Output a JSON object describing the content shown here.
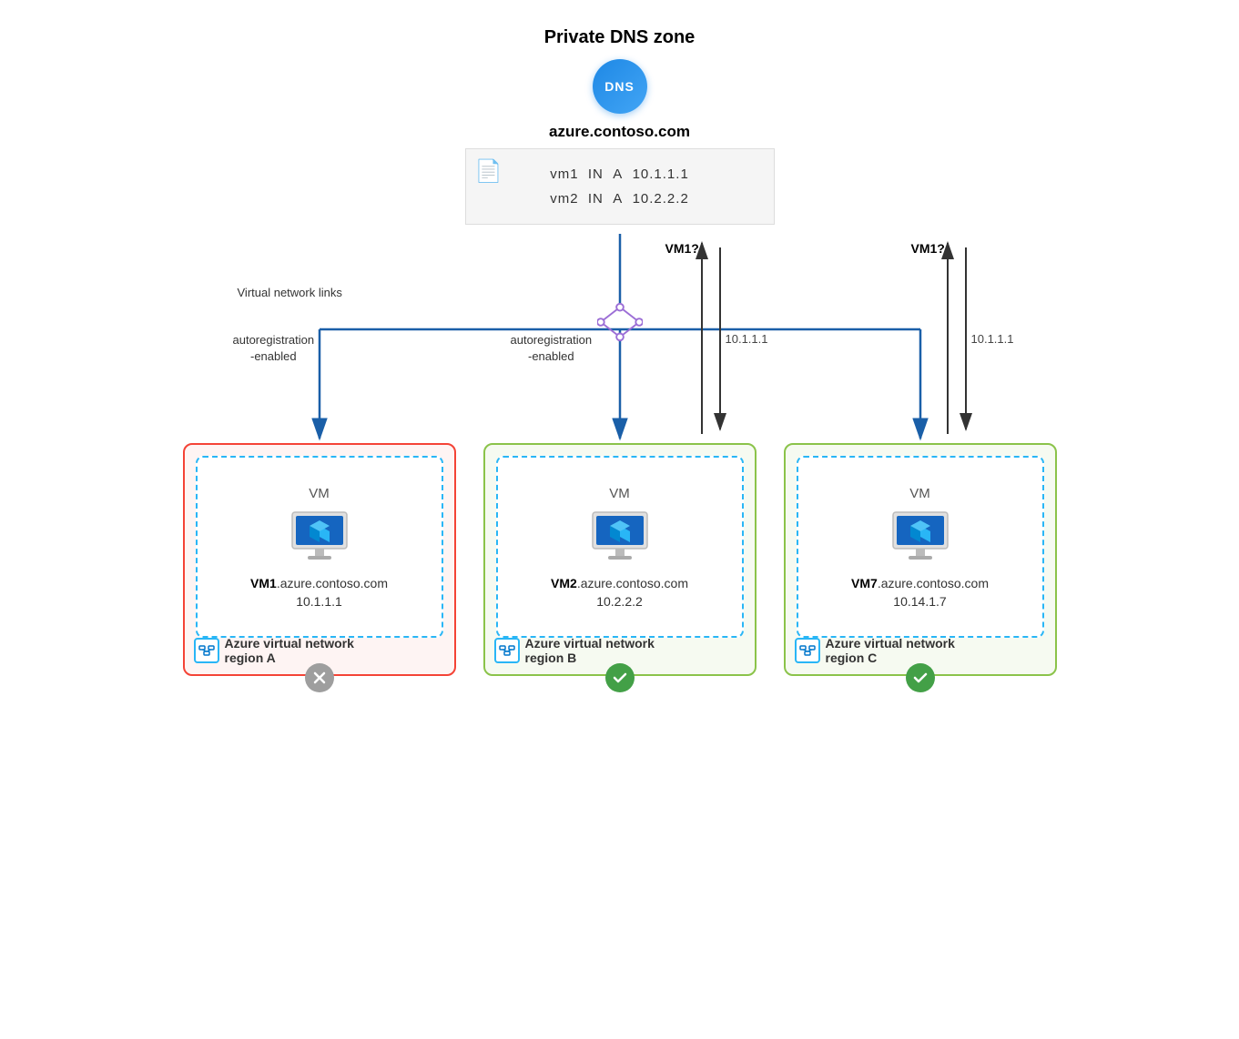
{
  "diagram": {
    "dns_section": {
      "title": "Private DNS zone",
      "icon_label": "DNS",
      "zone_name": "azure.contoso.com",
      "records": [
        {
          "name": "vm1",
          "class": "IN",
          "type": "A",
          "ip": "10.1.1.1"
        },
        {
          "name": "vm2",
          "class": "IN",
          "type": "A",
          "ip": "10.2.2.2"
        }
      ]
    },
    "middle_section": {
      "network_links_label": "Virtual network links",
      "autoregistration_left": "autoregistration\n-enabled",
      "autoregistration_center": "autoregistration\n-enabled",
      "vm1_query_center": "VM1?",
      "vm1_query_right": "VM1?",
      "ip_center": "10.1.1.1",
      "ip_right": "10.1.1.1"
    },
    "regions": [
      {
        "id": "region-a",
        "type": "red",
        "vm_label": "VM",
        "vm_name_bold": "VM1",
        "vm_name_suffix": ".azure.contoso.com",
        "vm_ip": "10.1.1.1",
        "region_name": "Azure virtual network\nregion A",
        "status": "error",
        "status_symbol": "✕"
      },
      {
        "id": "region-b",
        "type": "green",
        "vm_label": "VM",
        "vm_name_bold": "VM2",
        "vm_name_suffix": ".azure.contoso.com",
        "vm_ip": "10.2.2.2",
        "region_name": "Azure virtual network\nregion B",
        "status": "success",
        "status_symbol": "✓"
      },
      {
        "id": "region-c",
        "type": "green",
        "vm_label": "VM",
        "vm_name_bold": "VM7",
        "vm_name_suffix": ".azure.contoso.com",
        "vm_ip": "10.14.1.7",
        "region_name": "Azure virtual network\nregion C",
        "status": "success",
        "status_symbol": "✓"
      }
    ]
  }
}
